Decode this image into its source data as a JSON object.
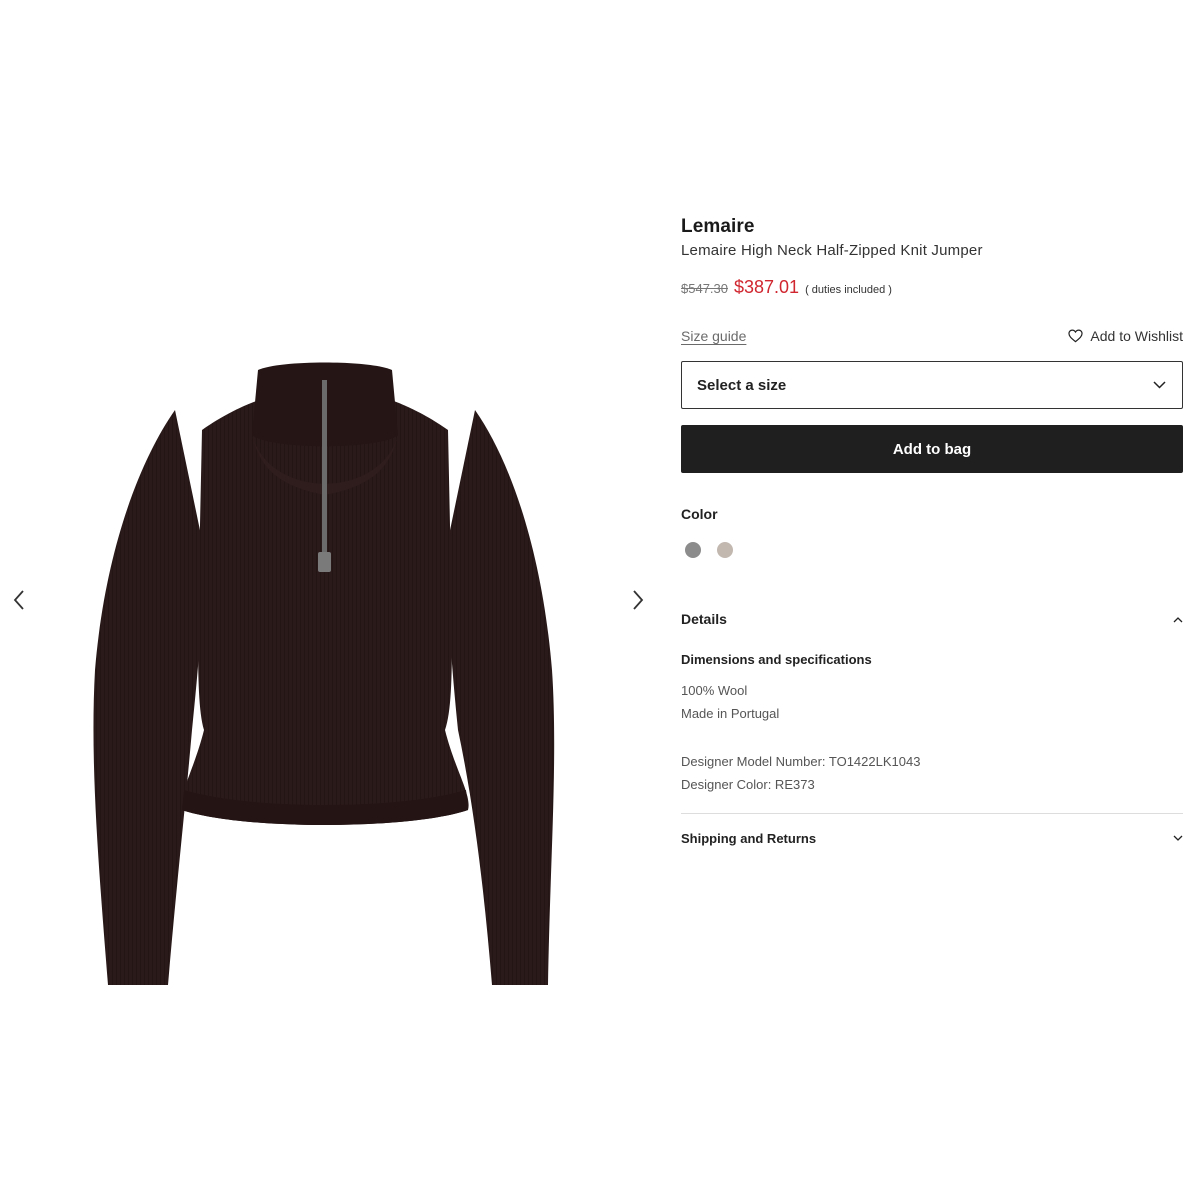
{
  "gallery": {
    "prev_icon": "chevron-left-icon",
    "next_icon": "chevron-right-icon",
    "image_alt": "Lemaire High Neck Half-Zipped Knit Jumper",
    "image_color": "#2b1a1a"
  },
  "product": {
    "brand": "Lemaire",
    "name": "Lemaire High Neck Half-Zipped Knit Jumper",
    "price_old": "$547.30",
    "price_new": "$387.01",
    "price_note": "( duties included )",
    "price_new_color": "#d0262f"
  },
  "size": {
    "guide_label": "Size guide",
    "wishlist_label": "Add to Wishlist",
    "wishlist_icon": "heart-icon",
    "select_label": "Select a size",
    "select_icon": "chevron-down-icon"
  },
  "actions": {
    "add_to_bag": "Add to bag"
  },
  "color": {
    "label": "Color",
    "swatches": [
      {
        "name": "grey",
        "hex": "#8c8c8c"
      },
      {
        "name": "taupe",
        "hex": "#c2b8b0"
      }
    ]
  },
  "details": {
    "title": "Details",
    "toggle_icon": "chevron-up-icon",
    "dimensions_title": "Dimensions and specifications",
    "specs_1": [
      "100% Wool",
      "Made in Portugal"
    ],
    "specs_2": [
      "Designer Model Number: TO1422LK1043",
      "Designer Color: RE373"
    ]
  },
  "shipping": {
    "title": "Shipping and Returns",
    "toggle_icon": "chevron-down-icon"
  }
}
